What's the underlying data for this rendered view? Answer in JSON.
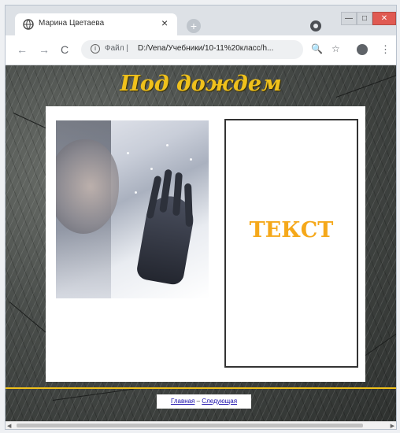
{
  "browser": {
    "tab_title": "Марина Цветаева",
    "tab_close": "×",
    "new_tab": "+",
    "nav_back": "←",
    "nav_forward": "→",
    "nav_reload": "C",
    "url_prefix": "Файл |",
    "url": "D:/Vena/Учебники/10-11%20класс/h...",
    "zoom_glyph": "🔍",
    "star_glyph": "☆",
    "menu_glyph": "⋮",
    "window_buttons": {
      "minimize": "—",
      "maximize": "□",
      "close": "✕"
    }
  },
  "page": {
    "heading": "Под дождем",
    "text_label": "ТЕКСТ",
    "nav": {
      "home": "Главная",
      "separator": " – ",
      "next": "Следующая"
    }
  },
  "colors": {
    "heading": "#f0c11c",
    "text_label": "#f5a81a",
    "divider": "#f0c11c",
    "background": "#4a4e4b"
  }
}
